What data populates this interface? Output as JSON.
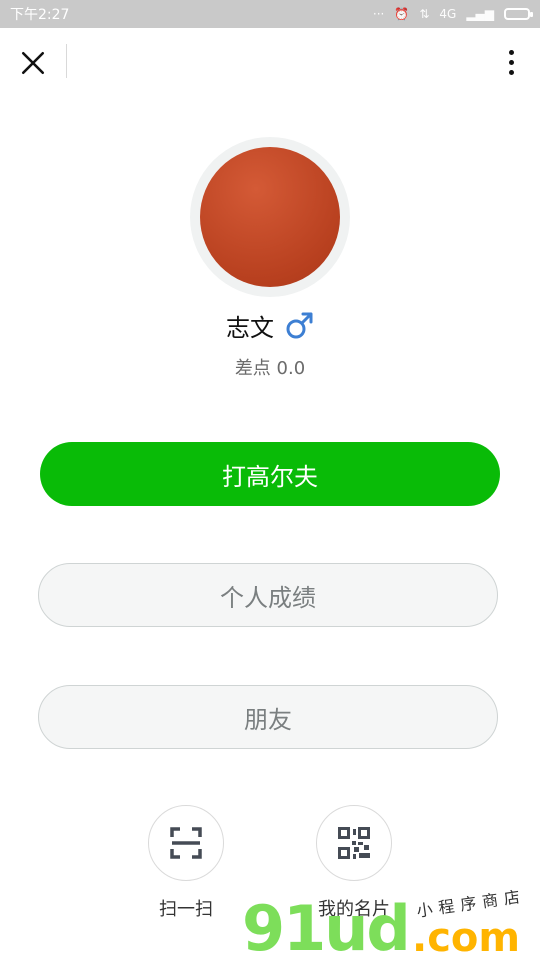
{
  "status_bar": {
    "time": "下午2:27",
    "net": "4G"
  },
  "nav": {
    "close_icon": "close-icon",
    "more_icon": "more-vertical-icon"
  },
  "profile": {
    "name": "志文",
    "gender": "male",
    "handicap": "差点 0.0"
  },
  "actions": {
    "play_golf": "打高尔夫",
    "personal_scores": "个人成绩",
    "friends": "朋友"
  },
  "quick_actions": [
    {
      "label": "扫一扫",
      "icon": "scan-icon"
    },
    {
      "label": "我的名片",
      "icon": "qr-code-icon"
    }
  ],
  "watermark": {
    "brand": "91ud",
    "domain": ".com",
    "tagline": "小程序商店"
  },
  "colors": {
    "primary": "#09bb07",
    "male": "#3d7fd3",
    "avatar": "#b8401f"
  }
}
